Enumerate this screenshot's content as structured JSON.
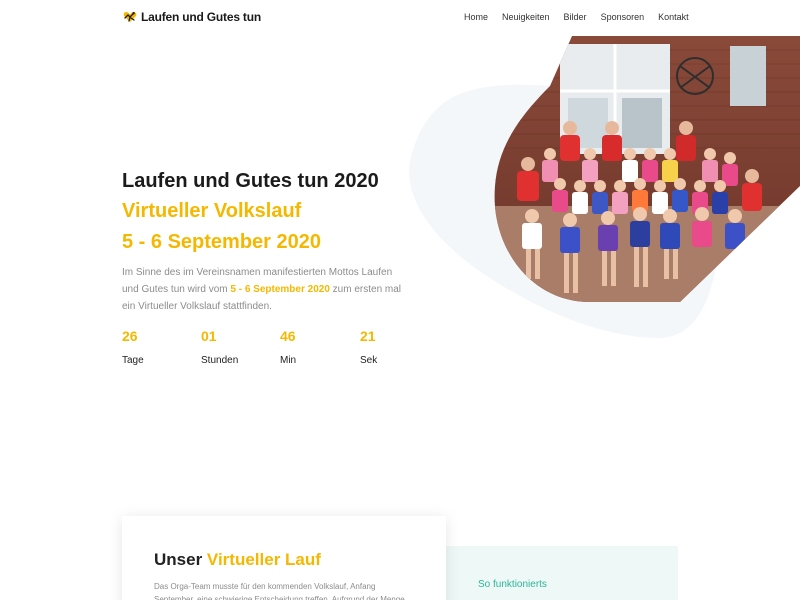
{
  "brand": {
    "name": "Laufen und Gutes tun",
    "logo_icon": "heart-runner-icon",
    "accent": "#f5b800"
  },
  "nav": [
    {
      "label": "Home"
    },
    {
      "label": "Neuigkeiten"
    },
    {
      "label": "Bilder"
    },
    {
      "label": "Sponsoren"
    },
    {
      "label": "Kontakt"
    }
  ],
  "hero": {
    "title": "Laufen und Gutes tun 2020",
    "subtitle1": "Virtueller Volkslauf",
    "subtitle2": "5 - 6 September 2020",
    "text_before": "Im Sinne des im Vereinsnamen manifestierten Mottos Laufen und Gutes tun wird vom ",
    "text_highlight": "5 - 6 September 2020",
    "text_after": " zum ersten mal ein Virtueller Volkslauf stattfinden.",
    "photo_alt": "Gruppenfoto mit Kindern und Betreuern"
  },
  "countdown": [
    {
      "value": "26",
      "label": "Tage"
    },
    {
      "value": "01",
      "label": "Stunden"
    },
    {
      "value": "46",
      "label": "Min"
    },
    {
      "value": "21",
      "label": "Sek"
    }
  ],
  "section": {
    "title_plain": "Unser ",
    "title_accent": "Virtueller Lauf",
    "text": "Das Orga-Team musste für den kommenden Volkslauf, Anfang September, eine schwierige Entscheidung treffen. Aufgrund der Menge",
    "steps_title": "So funktionierts"
  },
  "colors": {
    "accent": "#f5b800",
    "teal": "#2cb59a",
    "blob": "#f4f7fa",
    "panel": "#eef8f6"
  }
}
